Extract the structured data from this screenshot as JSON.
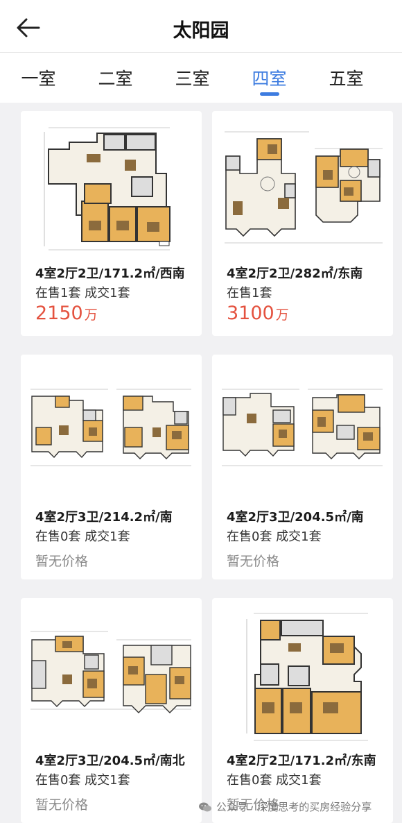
{
  "header": {
    "title": "太阳园"
  },
  "tabs": [
    {
      "label": "一室"
    },
    {
      "label": "二室"
    },
    {
      "label": "三室"
    },
    {
      "label": "四室",
      "active": true
    },
    {
      "label": "五室"
    }
  ],
  "colors": {
    "accent": "#3d7ce0",
    "price": "#e4523f",
    "muted": "#8a8a8a"
  },
  "listings": [
    {
      "title": "4室2厅2卫/171.2㎡/西南",
      "status": "在售1套 成交1套",
      "price": "2150",
      "price_unit": "万"
    },
    {
      "title": "4室2厅2卫/282㎡/东南",
      "status": "在售1套",
      "price": "3100",
      "price_unit": "万"
    },
    {
      "title": "4室2厅3卫/214.2㎡/南",
      "status": "在售0套 成交1套",
      "no_price": "暂无价格"
    },
    {
      "title": "4室2厅3卫/204.5㎡/南",
      "status": "在售0套 成交1套",
      "no_price": "暂无价格"
    },
    {
      "title": "4室2厅3卫/204.5㎡/南北",
      "status": "在售0套 成交1套",
      "no_price": "暂无价格"
    },
    {
      "title": "4室2厅2卫/171.2㎡/东南",
      "status": "在售0套 成交1套",
      "no_price": "暂无价格"
    }
  ],
  "watermark": {
    "text": "公众号 · 深度思考的买房经验分享",
    "icon": "wechat-icon"
  }
}
